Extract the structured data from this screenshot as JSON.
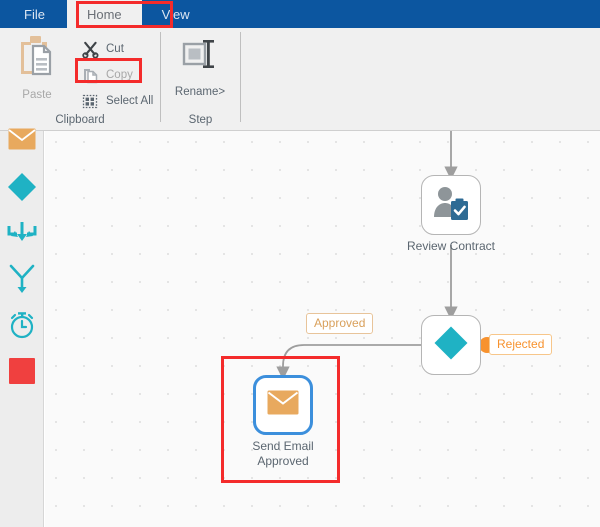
{
  "menubar": {
    "background": "#0C56A0",
    "items": [
      {
        "label": "File",
        "active": false
      },
      {
        "label": "Home",
        "active": true
      },
      {
        "label": "View",
        "active": false
      }
    ],
    "highlighted_item": "Home"
  },
  "ribbon": {
    "groups": [
      {
        "name": "Clipboard",
        "label": "Clipboard",
        "commands": [
          {
            "label": "Paste",
            "icon": "paste-icon",
            "enabled": false,
            "size": "large"
          },
          {
            "label": "Cut",
            "icon": "scissors-icon",
            "enabled": true,
            "size": "small"
          },
          {
            "label": "Copy",
            "icon": "copy-pages-icon",
            "enabled": false,
            "size": "small"
          },
          {
            "label": "Select All",
            "icon": "select-all-grid-icon",
            "enabled": true,
            "size": "small"
          }
        ]
      },
      {
        "name": "Step",
        "label": "Step",
        "commands": [
          {
            "label": "Rename>",
            "icon": "rename-textcursor-icon",
            "enabled": true,
            "size": "large"
          }
        ]
      }
    ],
    "highlighted_command": "Copy",
    "highlight_color": "#F42B2B"
  },
  "sidebar": {
    "items": [
      {
        "name": "send-email-tool",
        "icon": "envelope-icon",
        "color": "#E8A95E"
      },
      {
        "name": "decision-tool",
        "icon": "diamond-icon",
        "color": "#1FB2C4"
      },
      {
        "name": "merge-tool",
        "icon": "merge-arrows-icon",
        "color": "#1FB2C4"
      },
      {
        "name": "split-tool",
        "icon": "split-arrow-icon",
        "color": "#1FB2C4"
      },
      {
        "name": "timer-tool",
        "icon": "timer-icon",
        "color": "#1FB2C4"
      },
      {
        "name": "stop-tool",
        "icon": "stop-square-icon",
        "color": "#F0403F"
      }
    ]
  },
  "canvas": {
    "background": "#FAFAFA",
    "grid": "dots",
    "nodes": [
      {
        "id": "review-contract",
        "label": "Review Contract",
        "icon": "user-task-icon",
        "selected": false,
        "highlighted": false
      },
      {
        "id": "decision",
        "label": "",
        "icon": "diamond-icon",
        "selected": false,
        "highlighted": false,
        "port_color": "#F7922E"
      },
      {
        "id": "send-email-approved",
        "label": "Send Email\nApproved",
        "icon": "envelope-icon",
        "selected": true,
        "highlighted": true,
        "select_color": "#3C8FDC",
        "highlight_color": "#F42B2B"
      }
    ],
    "edge_labels": [
      {
        "id": "approved",
        "text": "Approved",
        "color": "#D9A05B"
      },
      {
        "id": "rejected",
        "text": "Rejected",
        "color": "#F7922E"
      }
    ]
  }
}
